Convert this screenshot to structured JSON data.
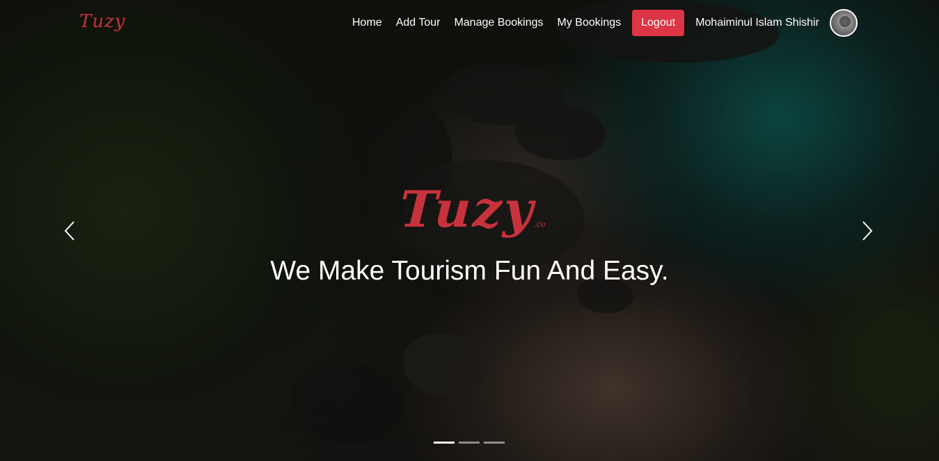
{
  "navbar": {
    "brand": "Tuzy",
    "brand_suffix": ".",
    "links": [
      {
        "label": "Home"
      },
      {
        "label": "Add Tour"
      },
      {
        "label": "Manage Bookings"
      },
      {
        "label": "My Bookings"
      }
    ],
    "logout_label": "Logout",
    "user_name": "Mohaiminul Islam Shishir",
    "avatar_icon": "user-avatar",
    "logout_color": "#dc3545",
    "brand_color": "#c8323c"
  },
  "hero": {
    "logo_text": "Tuzy",
    "logo_suffix": ".co",
    "tagline": "We Make Tourism Fun And Easy.",
    "prev_icon": "chevron-left-icon",
    "next_icon": "chevron-right-icon",
    "slides_count": 3,
    "active_slide": 1
  }
}
